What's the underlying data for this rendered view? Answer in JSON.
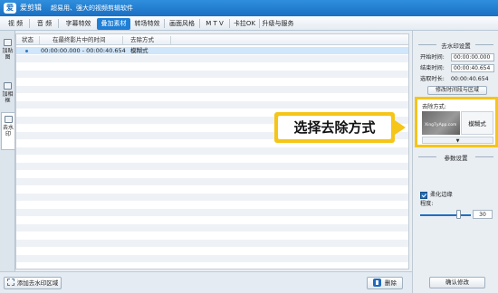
{
  "app": {
    "logo_glyph": "爱",
    "name": "爱剪辑",
    "slogan": "超易用、强大的视频剪辑软件"
  },
  "menu": {
    "tabs": [
      {
        "label": "视 频"
      },
      {
        "label": "音 频"
      },
      {
        "label": "字幕特效"
      },
      {
        "label": "叠加素材",
        "active": true
      },
      {
        "label": "转场特效"
      },
      {
        "label": "画面风格"
      },
      {
        "label": "M T V"
      },
      {
        "label": "卡拉OK"
      },
      {
        "label": "升级与服务"
      }
    ]
  },
  "sidebar": {
    "items": [
      {
        "label": "加贴图",
        "icon": "sticker-icon"
      },
      {
        "label": "加相框",
        "icon": "frame-icon"
      },
      {
        "label": "去水印",
        "icon": "watermark-icon",
        "active": true
      }
    ]
  },
  "table": {
    "columns": [
      "状态",
      "在最终影片中的时间",
      "去除方式"
    ],
    "rows": [
      {
        "time": "00:00:00.000 - 00:00:40.654",
        "method": "模糊式",
        "selected": true
      }
    ]
  },
  "bottom": {
    "add_label": "添加去水印区域",
    "delete_label": "删除"
  },
  "panel": {
    "settings_title": "去水印设置",
    "start_label": "开始时间:",
    "start_value": "00:00:00.000",
    "end_label": "结束时间:",
    "end_value": "00:00:40.654",
    "duration_label": "选取时长:",
    "duration_value": "00:00:40.654",
    "modify_time_label": "修改时间段与区域",
    "removal_label": "去除方式:",
    "method_watermark_text": "Xing7yApp.com",
    "method_name": "模糊式",
    "dropdown_arrow": "▼",
    "params_title": "参数设置",
    "soften_label": "柔化边缘",
    "soften_checked": true,
    "degree_label": "程度:",
    "degree_value": "30",
    "confirm_label": "确认修改"
  },
  "callout": {
    "text": "选择去除方式"
  },
  "colors": {
    "accent": "#1f7fd6",
    "highlight": "#f5c518",
    "selected_row": "#cfe6fb"
  }
}
